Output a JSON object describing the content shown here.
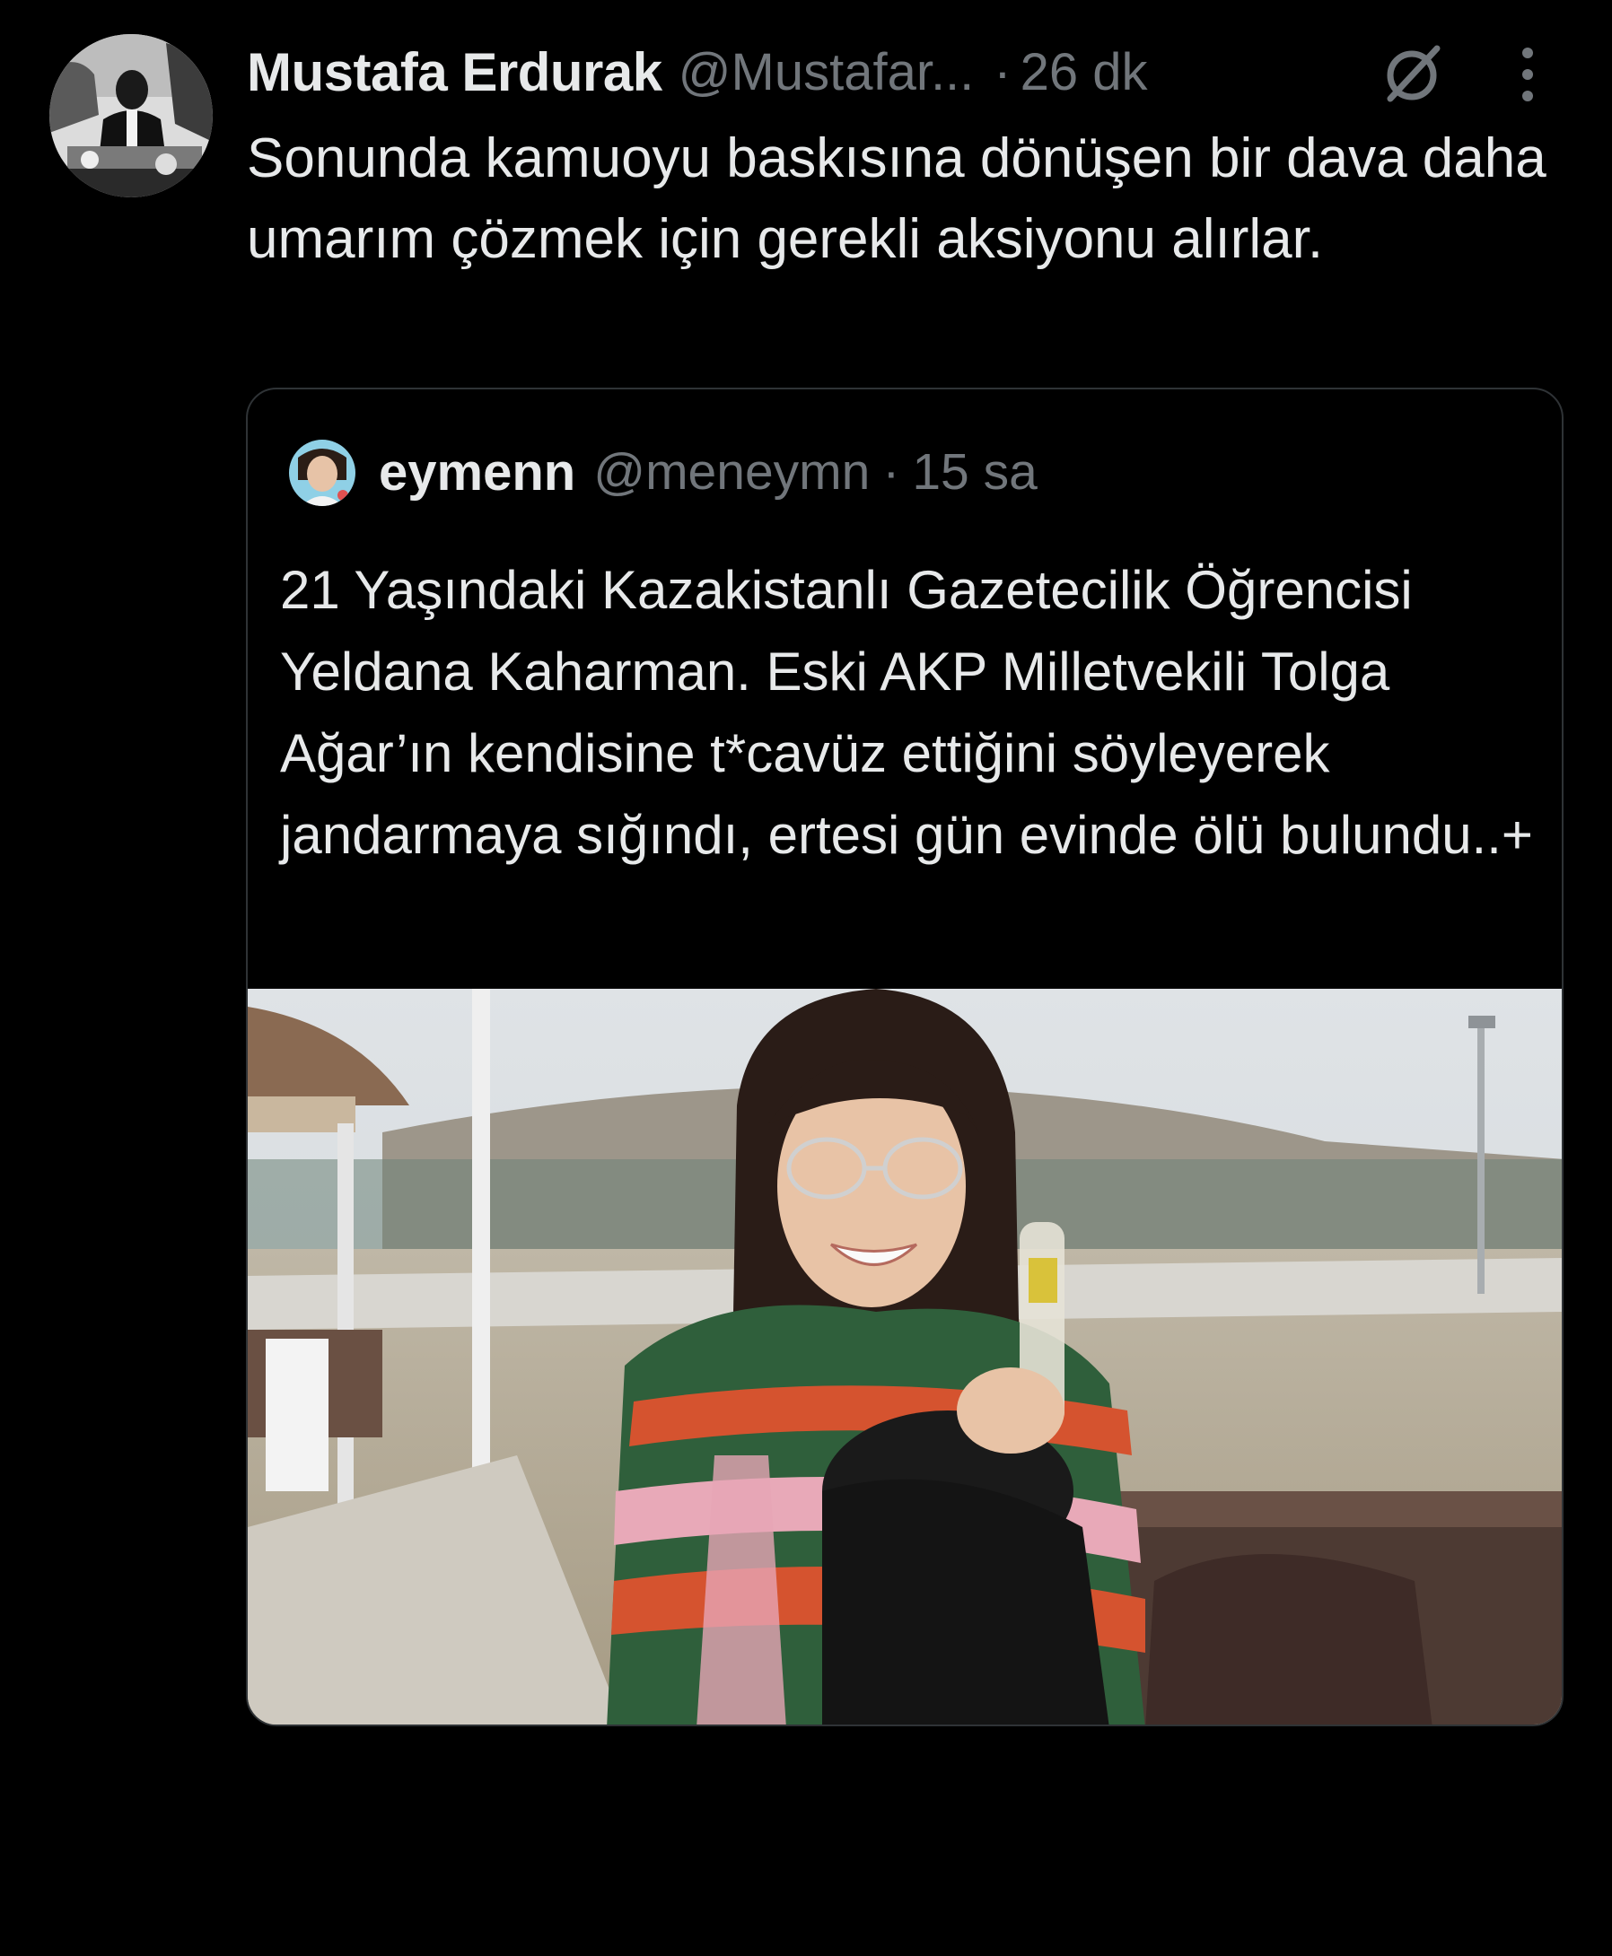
{
  "tweet": {
    "author": {
      "display_name": "Mustafa Erdurak",
      "handle": "@Mustafar...",
      "avatar_icon": "user-avatar"
    },
    "separator": "·",
    "time": "26 dk",
    "grok_icon": "grok-icon",
    "more_icon": "more-vertical-icon",
    "text": "Sonunda kamuoyu baskısına dönüşen bir dava daha umarım çözmek için gerekli aksiyonu alırlar."
  },
  "quoted_tweet": {
    "author": {
      "display_name": "eymenn",
      "handle": "@meneymn",
      "avatar_icon": "user-avatar"
    },
    "separator": "·",
    "time": "15 sa",
    "text": "21 Yaşındaki Kazakistanlı Gazetecilik Öğrencisi Yeldana Kaharman. Eski AKP Milletvekili Tolga Ağar’ın kendisine t*cavüz ettiğini söyleyerek jandarmaya sığındı, ertesi gün evinde ölü bulundu..+"
  },
  "colors": {
    "background": "#000000",
    "primary_text": "#e7e9ea",
    "secondary_text": "#71767b",
    "border": "#2f3336"
  }
}
